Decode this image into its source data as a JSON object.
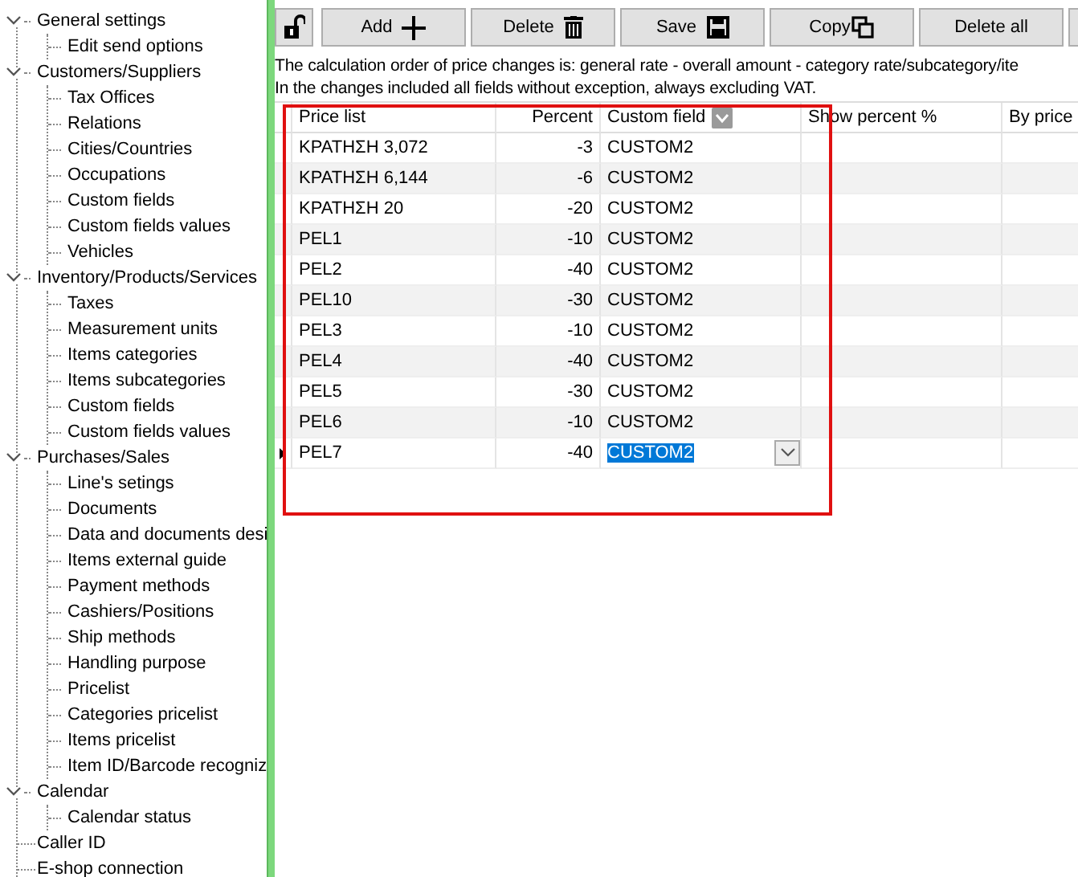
{
  "sidebar": {
    "items": [
      {
        "label": "General settings",
        "expanded": true,
        "children": [
          {
            "label": "Edit send options"
          }
        ]
      },
      {
        "label": "Customers/Suppliers",
        "expanded": true,
        "children": [
          {
            "label": "Tax Offices"
          },
          {
            "label": "Relations"
          },
          {
            "label": "Cities/Countries"
          },
          {
            "label": "Occupations"
          },
          {
            "label": "Custom fields"
          },
          {
            "label": "Custom fields values"
          },
          {
            "label": "Vehicles"
          }
        ]
      },
      {
        "label": "Inventory/Products/Services",
        "expanded": true,
        "children": [
          {
            "label": "Taxes"
          },
          {
            "label": "Measurement units"
          },
          {
            "label": "Items categories"
          },
          {
            "label": "Items subcategories"
          },
          {
            "label": "Custom fields"
          },
          {
            "label": "Custom fields values"
          }
        ]
      },
      {
        "label": "Purchases/Sales",
        "expanded": true,
        "children": [
          {
            "label": "Line's setings"
          },
          {
            "label": "Documents"
          },
          {
            "label": "Data and documents desi"
          },
          {
            "label": "Items external guide"
          },
          {
            "label": "Payment methods"
          },
          {
            "label": "Cashiers/Positions"
          },
          {
            "label": "Ship methods"
          },
          {
            "label": "Handling purpose"
          },
          {
            "label": "Pricelist"
          },
          {
            "label": "Categories pricelist"
          },
          {
            "label": "Items pricelist"
          },
          {
            "label": "Item ID/Barcode recogniz"
          }
        ]
      },
      {
        "label": "Calendar",
        "expanded": true,
        "children": [
          {
            "label": "Calendar status"
          }
        ]
      },
      {
        "label": "Caller ID"
      },
      {
        "label": "E-shop connection"
      }
    ]
  },
  "toolbar": [
    {
      "kind": "lock"
    },
    {
      "kind": "add",
      "label": "Add"
    },
    {
      "kind": "delete",
      "label": "Delete"
    },
    {
      "kind": "save",
      "label": "Save"
    },
    {
      "kind": "copy",
      "label": "Copy"
    },
    {
      "kind": "delete_all",
      "label": "Delete all"
    },
    {
      "kind": "more"
    }
  ],
  "notes": [
    "The calculation order of price changes  is: general rate - overall amount - category rate/subcategory/ite",
    "In the changes included all fields without exception, always excluding VAT."
  ],
  "table": {
    "columns": [
      "Price list",
      "Percent",
      "Custom field",
      "Show percent %",
      "By price"
    ],
    "rows": [
      {
        "price_list": "ΚΡΑΤΗΣΗ 3,072",
        "percent": "-3",
        "custom_field": "CUSTOM2",
        "selected": false
      },
      {
        "price_list": "ΚΡΑΤΗΣΗ 6,144",
        "percent": "-6",
        "custom_field": "CUSTOM2",
        "selected": false
      },
      {
        "price_list": "ΚΡΑΤΗΣΗ 20",
        "percent": "-20",
        "custom_field": "CUSTOM2",
        "selected": false
      },
      {
        "price_list": "PEL1",
        "percent": "-10",
        "custom_field": "CUSTOM2",
        "selected": false
      },
      {
        "price_list": "PEL2",
        "percent": "-40",
        "custom_field": "CUSTOM2",
        "selected": false
      },
      {
        "price_list": "PEL10",
        "percent": "-30",
        "custom_field": "CUSTOM2",
        "selected": false
      },
      {
        "price_list": "PEL3",
        "percent": "-10",
        "custom_field": "CUSTOM2",
        "selected": false
      },
      {
        "price_list": "PEL4",
        "percent": "-40",
        "custom_field": "CUSTOM2",
        "selected": false
      },
      {
        "price_list": "PEL5",
        "percent": "-30",
        "custom_field": "CUSTOM2",
        "selected": false
      },
      {
        "price_list": "PEL6",
        "percent": "-10",
        "custom_field": "CUSTOM2",
        "selected": false
      },
      {
        "price_list": "PEL7",
        "percent": "-40",
        "custom_field": "CUSTOM2",
        "selected": true
      }
    ]
  }
}
